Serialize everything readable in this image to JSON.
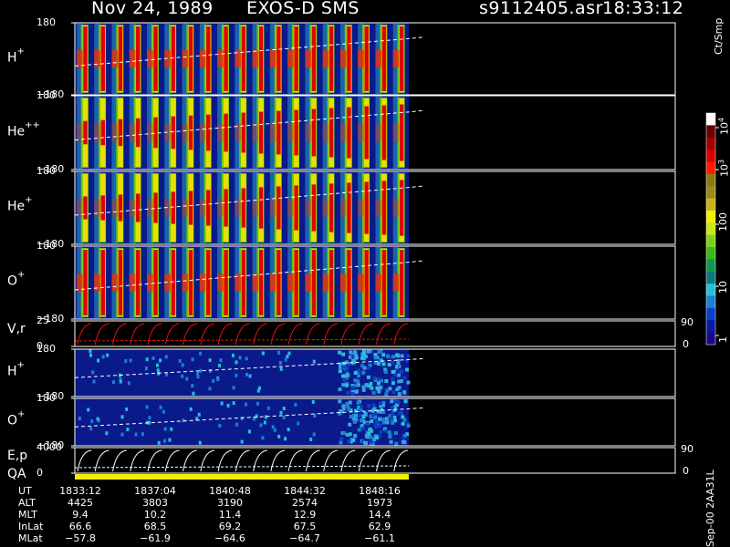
{
  "header": {
    "date": "Nov 24, 1989",
    "instrument": "EXOS-D SMS",
    "file": "s9112405.asr",
    "time": "18:33:12"
  },
  "colorbar": {
    "title": "Ct/Smp",
    "ticks": [
      "1",
      "10",
      "100",
      "10",
      "10"
    ],
    "tick_exps": [
      "",
      "",
      "",
      "3",
      "4"
    ],
    "colors": [
      "#1a0a8a",
      "#0a1aa0",
      "#0b3fc4",
      "#1f7fd0",
      "#27bfd6",
      "#0b7a7a",
      "#0f9a4a",
      "#39b818",
      "#7ed11a",
      "#c8e61a",
      "#f0f000",
      "#c9b21b",
      "#9a8a1a",
      "#8a7a10",
      "#ff1a00",
      "#d80000",
      "#a00000",
      "#6a0000",
      "#ffffff"
    ]
  },
  "panels": [
    {
      "id": "h-plus",
      "label": "H",
      "sup": "+",
      "ymax": "180",
      "ymin": "−180"
    },
    {
      "id": "he-plus-plus",
      "label": "He",
      "sup": "++",
      "ymax": "180",
      "ymin": "−180"
    },
    {
      "id": "he-plus",
      "label": "He",
      "sup": "+",
      "ymax": "180",
      "ymin": "−180"
    },
    {
      "id": "o-plus",
      "label": "O",
      "sup": "+",
      "ymax": "180",
      "ymin": "−180"
    },
    {
      "id": "vr",
      "label": "V,r",
      "sup": "",
      "ymax": "25",
      "ymin": "0",
      "rmax": "90",
      "rmin": "0"
    },
    {
      "id": "h-plus-2",
      "label": "H",
      "sup": "+",
      "ymax": "180",
      "ymin": "−180"
    },
    {
      "id": "o-plus-2",
      "label": "O",
      "sup": "+",
      "ymax": "180",
      "ymin": "−180"
    },
    {
      "id": "ep",
      "label": "E,p",
      "sup": "",
      "ymax": "4000",
      "ymin": "0",
      "rmax": "90",
      "rmin": "0"
    }
  ],
  "qa_label": "QA",
  "colors": {
    "background": "#000000",
    "panel_bg": "#0a1a8a",
    "attitude": "#e81010",
    "energy": "#ffffff",
    "qa_bar": "#f4f000"
  },
  "chart_data": {
    "type": "heatmap",
    "x_time_labels": [
      "1833:12",
      "1837:04",
      "1840:48",
      "1844:32",
      "1848:16"
    ],
    "data_coverage_fraction": 0.5,
    "spin_cycles": 19,
    "colorscale": "log",
    "color_range_ct_per_smp": [
      1,
      10000
    ]
  },
  "footer": {
    "rows": [
      {
        "name": "UT",
        "values": [
          "1833:12",
          "1837:04",
          "1840:48",
          "1844:32",
          "1848:16"
        ]
      },
      {
        "name": "ALT",
        "values": [
          "4425",
          "3803",
          "3190",
          "2574",
          "1973"
        ]
      },
      {
        "name": "MLT",
        "values": [
          "9.4",
          "10.2",
          "11.4",
          "12.9",
          "14.4"
        ]
      },
      {
        "name": "InLat",
        "values": [
          "66.6",
          "68.5",
          "69.2",
          "67.5",
          "62.9"
        ]
      },
      {
        "name": "MLat",
        "values": [
          "−57.8",
          "−61.9",
          "−64.6",
          "−64.7",
          "−61.1"
        ]
      }
    ]
  },
  "stamp": "Sep-00 2AA31L"
}
